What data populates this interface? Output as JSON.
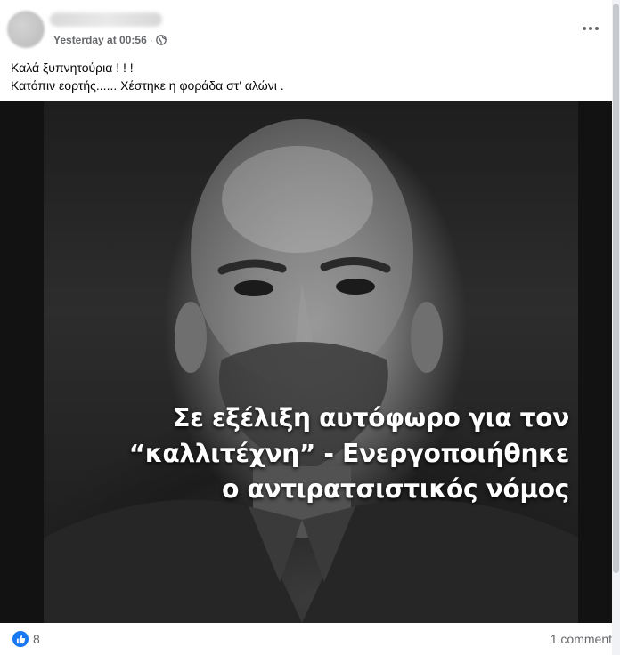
{
  "post": {
    "timestamp": "Yesterday at 00:56",
    "separator": "·",
    "privacy_icon": "globe-icon",
    "text_lines": [
      "Καλά ξυπνητούρια ! ! !",
      "Κατόπιν εορτής...... Χέστηκε η φοράδα στ' αλώνι ."
    ],
    "image_caption_lines": [
      "Σε εξέλιξη αυτόφωρο για τον",
      "“καλλιτέχνη” - Ενεργοποιήθηκε",
      "ο αντιρατσιστικός νόμος"
    ]
  },
  "footer": {
    "reaction_icon": "like-icon",
    "reaction_count": "8",
    "comments_label": "1 comment"
  },
  "colors": {
    "accent": "#1877f2",
    "secondary_text": "#65676b",
    "primary_text": "#050505"
  }
}
